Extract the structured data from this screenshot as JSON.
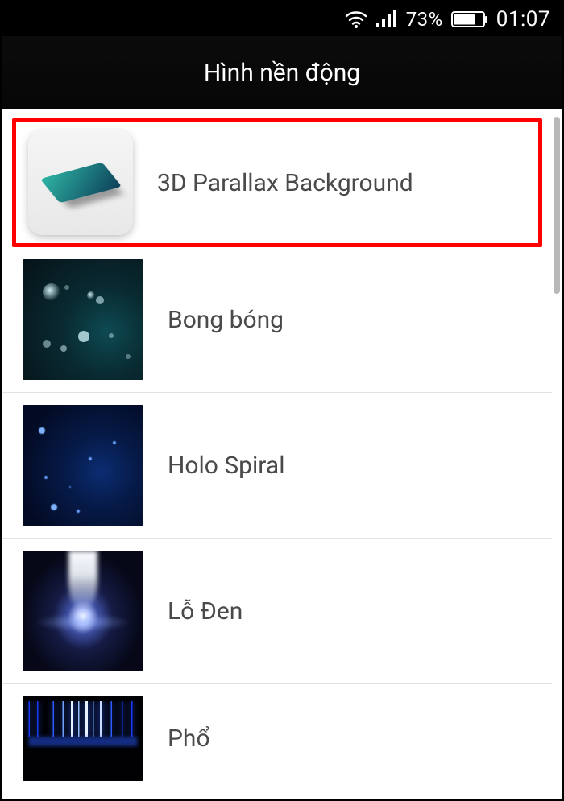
{
  "status": {
    "battery_pct": "73%",
    "clock": "01:07"
  },
  "header": {
    "title": "Hình nền động"
  },
  "list": {
    "items": [
      {
        "label": "3D Parallax Background",
        "icon": "app",
        "highlighted": true
      },
      {
        "label": "Bong bóng",
        "icon": "bubbles",
        "highlighted": false
      },
      {
        "label": "Holo Spiral",
        "icon": "holo",
        "highlighted": false
      },
      {
        "label": "Lỗ Đen",
        "icon": "blackhole",
        "highlighted": false
      },
      {
        "label": "Phổ",
        "icon": "spectrum",
        "highlighted": false
      }
    ]
  }
}
